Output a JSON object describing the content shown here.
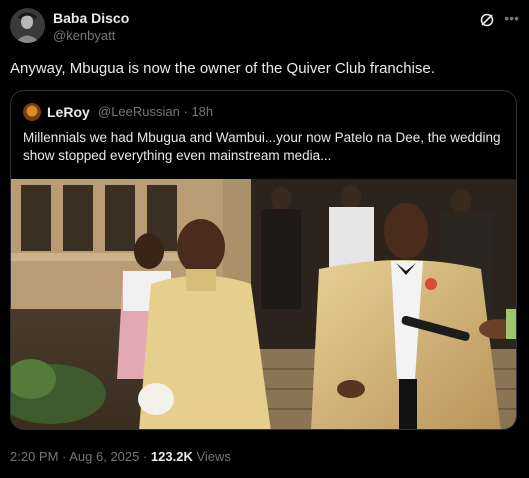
{
  "author": {
    "name": "Baba Disco",
    "handle": "@kenbyatt"
  },
  "tweet": {
    "text": "Anyway, Mbugua is now the owner of the Quiver Club franchise."
  },
  "quoted": {
    "name": "LeRoy",
    "handle": "@LeeRussian",
    "separator": "·",
    "time": "18h",
    "text": "Millennials we had Mbugua and Wambui...your now Patelo na Dee, the wedding show stopped everything even mainstream media...",
    "image": "photo-wedding-couple"
  },
  "footer": {
    "timestamp": "2:20 PM · Aug 6, 2025 · ",
    "views_count": "123.2K",
    "views_label": " Views"
  },
  "icons": {
    "grok": "grok-icon",
    "more": "more-icon"
  },
  "colors": {
    "background": "#000000",
    "text": "#e7e9ea",
    "muted": "#71767b",
    "border": "#2f3336"
  }
}
